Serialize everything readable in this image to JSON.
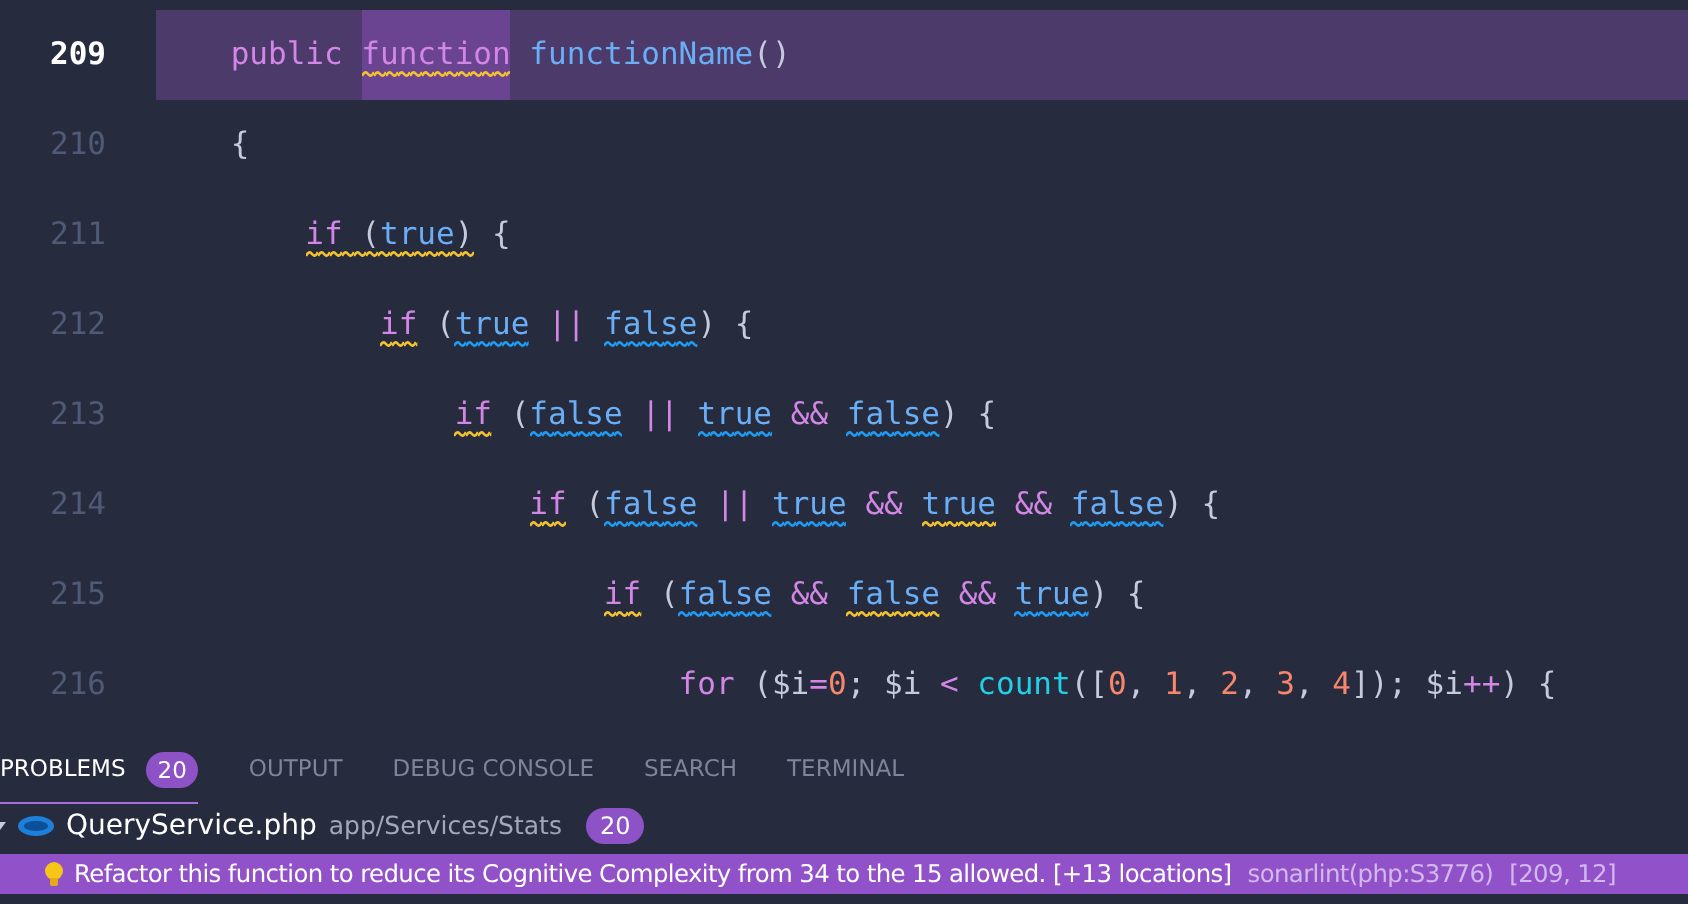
{
  "editor": {
    "lines": [
      {
        "number": "209",
        "active": true,
        "tokens": [
          {
            "text": "    public ",
            "color": "#d286e6",
            "highlighted": false
          },
          {
            "text": "function",
            "color": "#d286e6",
            "highlighted": true,
            "squiggle": {
              "color": "#f2c12e"
            }
          },
          {
            "text": " functionName",
            "color": "#6aaef5",
            "highlighted": false
          },
          {
            "text": "()",
            "color": "#c5cbdc",
            "highlighted": false
          }
        ]
      },
      {
        "number": "210",
        "active": false,
        "tokens": [
          {
            "text": "    {",
            "color": "#c5cbdc",
            "highlighted": false
          }
        ]
      },
      {
        "number": "211",
        "active": false,
        "tokens": [
          {
            "parts": [
              {
                "text": "        if",
                "color": "#d286e6"
              },
              {
                "text": " (",
                "color": "#c5cbdc"
              },
              {
                "text": "true",
                "color": "#6aaef5"
              },
              {
                "text": ")",
                "color": "#c5cbdc"
              }
            ],
            "squiggle": {
              "color": "#f2c12e"
            },
            "highlighted": false
          },
          {
            "text": " {",
            "color": "#c5cbdc",
            "highlighted": false
          }
        ]
      },
      {
        "number": "212",
        "active": false,
        "tokens": [
          {
            "text": "            if",
            "color": "#d286e6",
            "squiggle": {
              "color": "#f2c12e"
            },
            "highlighted": false
          },
          {
            "text": " (",
            "color": "#c5cbdc",
            "highlighted": false
          },
          {
            "text": "true",
            "color": "#6aaef5",
            "squiggle": {
              "color": "#1e9bf0"
            },
            "highlighted": false
          },
          {
            "text": " || ",
            "color": "#d286e6",
            "highlighted": false
          },
          {
            "text": "false",
            "color": "#6aaef5",
            "squiggle": {
              "color": "#1e9bf0"
            },
            "highlighted": false
          },
          {
            "text": ") {",
            "color": "#c5cbdc",
            "highlighted": false
          }
        ]
      },
      {
        "number": "213",
        "active": false,
        "tokens": [
          {
            "text": "                if",
            "color": "#d286e6",
            "squiggle": {
              "color": "#f2c12e"
            },
            "highlighted": false
          },
          {
            "text": " (",
            "color": "#c5cbdc",
            "highlighted": false
          },
          {
            "text": "false",
            "color": "#6aaef5",
            "squiggle": {
              "color": "#1e9bf0"
            },
            "highlighted": false
          },
          {
            "text": " || ",
            "color": "#d286e6",
            "highlighted": false
          },
          {
            "text": "true",
            "color": "#6aaef5",
            "squiggle": {
              "color": "#1e9bf0"
            },
            "highlighted": false
          },
          {
            "text": " && ",
            "color": "#d286e6",
            "highlighted": false
          },
          {
            "text": "false",
            "color": "#6aaef5",
            "squiggle": {
              "color": "#1e9bf0"
            },
            "highlighted": false
          },
          {
            "text": ") {",
            "color": "#c5cbdc",
            "highlighted": false
          }
        ]
      },
      {
        "number": "214",
        "active": false,
        "tokens": [
          {
            "text": "                    if",
            "color": "#d286e6",
            "squiggle": {
              "color": "#f2c12e"
            },
            "highlighted": false
          },
          {
            "text": " (",
            "color": "#c5cbdc",
            "highlighted": false
          },
          {
            "text": "false",
            "color": "#6aaef5",
            "squiggle": {
              "color": "#1e9bf0"
            },
            "highlighted": false
          },
          {
            "text": " || ",
            "color": "#d286e6",
            "highlighted": false
          },
          {
            "text": "true",
            "color": "#6aaef5",
            "squiggle": {
              "color": "#1e9bf0"
            },
            "highlighted": false
          },
          {
            "text": " && ",
            "color": "#d286e6",
            "highlighted": false
          },
          {
            "text": "true",
            "color": "#6aaef5",
            "squiggle": {
              "color": "#f2c12e"
            },
            "highlighted": false
          },
          {
            "text": " && ",
            "color": "#d286e6",
            "highlighted": false
          },
          {
            "text": "false",
            "color": "#6aaef5",
            "squiggle": {
              "color": "#1e9bf0"
            },
            "highlighted": false
          },
          {
            "text": ") {",
            "color": "#c5cbdc",
            "highlighted": false
          }
        ]
      },
      {
        "number": "215",
        "active": false,
        "tokens": [
          {
            "text": "                        if",
            "color": "#d286e6",
            "squiggle": {
              "color": "#f2c12e"
            },
            "highlighted": false
          },
          {
            "text": " (",
            "color": "#c5cbdc",
            "highlighted": false
          },
          {
            "text": "false",
            "color": "#6aaef5",
            "squiggle": {
              "color": "#1e9bf0"
            },
            "highlighted": false
          },
          {
            "text": " && ",
            "color": "#d286e6",
            "highlighted": false
          },
          {
            "text": "false",
            "color": "#6aaef5",
            "squiggle": {
              "color": "#f2c12e"
            },
            "highlighted": false
          },
          {
            "text": " && ",
            "color": "#d286e6",
            "highlighted": false
          },
          {
            "text": "true",
            "color": "#6aaef5",
            "squiggle": {
              "color": "#1e9bf0"
            },
            "highlighted": false
          },
          {
            "text": ") {",
            "color": "#c5cbdc",
            "highlighted": false
          }
        ]
      },
      {
        "number": "216",
        "active": false,
        "tokens": [
          {
            "text": "                            for",
            "color": "#d286e6",
            "highlighted": false
          },
          {
            "text": " ($i",
            "color": "#c5cbdc",
            "highlighted": false
          },
          {
            "text": "=",
            "color": "#d286e6",
            "highlighted": false
          },
          {
            "text": "0",
            "color": "#f7866c",
            "highlighted": false
          },
          {
            "text": "; $i",
            "color": "#c5cbdc",
            "highlighted": false
          },
          {
            "text": " < ",
            "color": "#d286e6",
            "highlighted": false
          },
          {
            "text": "count",
            "color": "#22cfe6",
            "highlighted": false
          },
          {
            "text": "([",
            "color": "#c5cbdc",
            "highlighted": false
          },
          {
            "text": "0",
            "color": "#f7866c",
            "highlighted": false
          },
          {
            "text": ",",
            "color": "#c5cbdc",
            "highlighted": false
          },
          {
            "text": " 1",
            "color": "#f7866c",
            "highlighted": false
          },
          {
            "text": ",",
            "color": "#c5cbdc",
            "highlighted": false
          },
          {
            "text": " 2",
            "color": "#f7866c",
            "highlighted": false
          },
          {
            "text": ",",
            "color": "#c5cbdc",
            "highlighted": false
          },
          {
            "text": " 3",
            "color": "#f7866c",
            "highlighted": false
          },
          {
            "text": ",",
            "color": "#c5cbdc",
            "highlighted": false
          },
          {
            "text": " 4",
            "color": "#f7866c",
            "highlighted": false
          },
          {
            "text": "]); $i",
            "color": "#c5cbdc",
            "highlighted": false
          },
          {
            "text": "++",
            "color": "#d286e6",
            "highlighted": false
          },
          {
            "text": ") {",
            "color": "#c5cbdc",
            "highlighted": false
          }
        ]
      }
    ]
  },
  "panel": {
    "tabs": [
      {
        "label": "PROBLEMS",
        "badge": "20",
        "selected": true
      },
      {
        "label": "OUTPUT",
        "selected": false
      },
      {
        "label": "DEBUG CONSOLE",
        "selected": false
      },
      {
        "label": "SEARCH",
        "selected": false
      },
      {
        "label": "TERMINAL",
        "selected": false
      }
    ],
    "file": {
      "expanded": true,
      "name": "QueryService.php",
      "path": "app/Services/Stats",
      "count": "20"
    },
    "problems": [
      {
        "selected": true,
        "message": "Refactor this function to reduce its Cognitive Complexity from 34 to the 15 allowed. [+13 locations]",
        "source": "sonarlint(php:S3776)",
        "position": "[209, 12]"
      }
    ]
  }
}
